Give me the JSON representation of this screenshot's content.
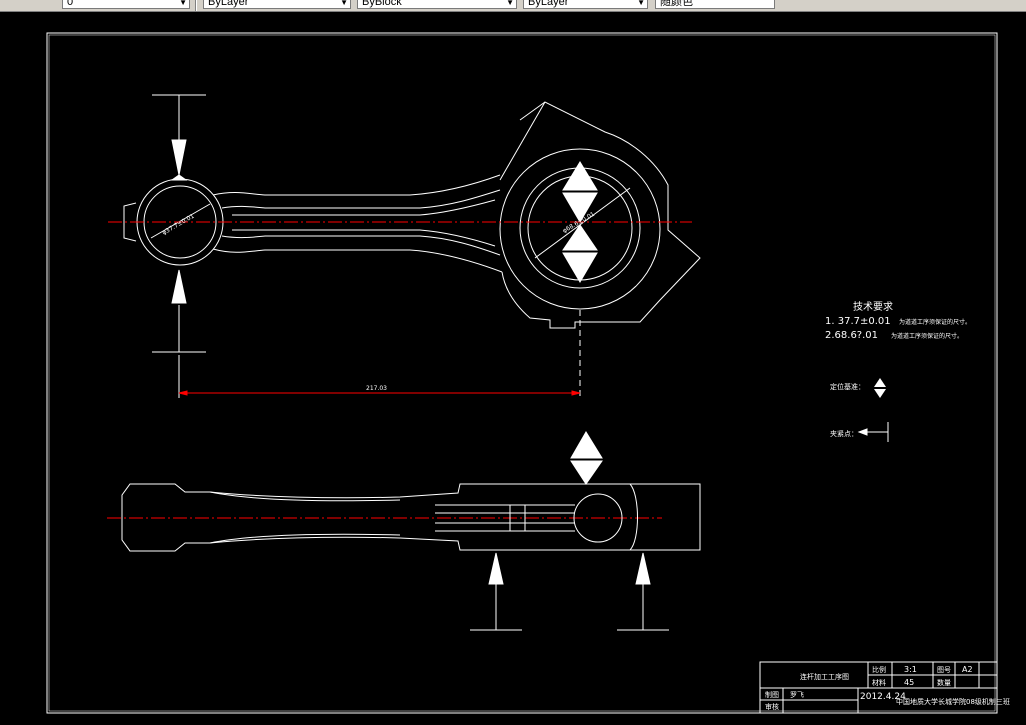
{
  "toolbar": {
    "layer_label": "0",
    "color_label": "ByLayer",
    "linetype_label": "ByBlock",
    "lineweight_label": "ByLayer",
    "plotstyle_label": "随颜色"
  },
  "drawing": {
    "tech_title": "技术要求",
    "tech_line1_num": "1. 37.7±0.01",
    "tech_line1_text": "为道道工序须保证的尺寸。",
    "tech_line2_num": "2.68.6?.01",
    "tech_line2_text": "为道道工序须保证的尺寸。",
    "legend_locate": "定位基准：",
    "legend_clamp": "夹紧点：",
    "dim_left": "φ37.7±0.01",
    "dim_right": "φ68.6±0.01",
    "dim_center": "217.03"
  },
  "title_block": {
    "drawing_name": "连杆加工工序图",
    "scale_label": "比例",
    "scale_value": "3:1",
    "sheet_label": "图号",
    "sheet_value": "A2",
    "material_label": "材料",
    "material_value": "45",
    "qty_label": "数量",
    "drawn_label": "制图",
    "drawn_name": "罗飞",
    "date": "2012.4.24",
    "check_label": "审核",
    "school": "中国地质大学长城学院08级机制三班"
  },
  "colors": {
    "background": "#000000",
    "lines": "#ffffff",
    "centerline": "#ff0000",
    "toolbar": "#d4d0c8"
  }
}
